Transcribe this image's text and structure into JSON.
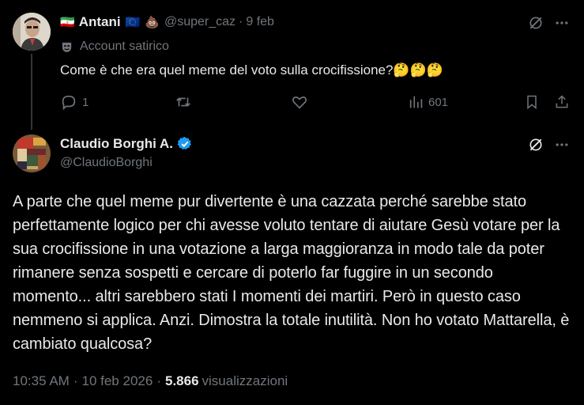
{
  "parent_tweet": {
    "flag_left": "🇮🇷",
    "display_name": "Antani",
    "flag_right": "🇪🇺",
    "emoji": "💩",
    "handle": "@super_caz",
    "separator": "·",
    "date": "9 feb",
    "label_icon": "mask-icon",
    "label": "Account satirico",
    "text": "Come è che era quel meme del voto sulla crocifissione?🤔🤔🤔",
    "replies": "1",
    "views": "601"
  },
  "main_tweet": {
    "display_name": "Claudio Borghi A.",
    "verified": true,
    "handle": "@ClaudioBorghi",
    "text": "A parte che quel meme pur divertente è una cazzata perché sarebbe stato perfettamente logico per chi avesse voluto tentare di aiutare Gesù votare per la sua crocifissione in una votazione a larga maggioranza in modo tale da poter rimanere senza sospetti e cercare di poterlo far fuggire in un secondo momento... altri sarebbero stati I momenti dei martiri. Però in questo caso nemmeno si applica. Anzi. Dimostra la totale inutilità. Non ho votato Mattarella, è cambiato qualcosa?",
    "time": "10:35 AM",
    "separator": "·",
    "date": "10 feb 2026",
    "views_count": "5.866",
    "views_label": "visualizzazioni"
  },
  "colors": {
    "background": "#000000",
    "text": "#e7e9ea",
    "muted": "#71767b",
    "verified": "#1d9bf0"
  }
}
